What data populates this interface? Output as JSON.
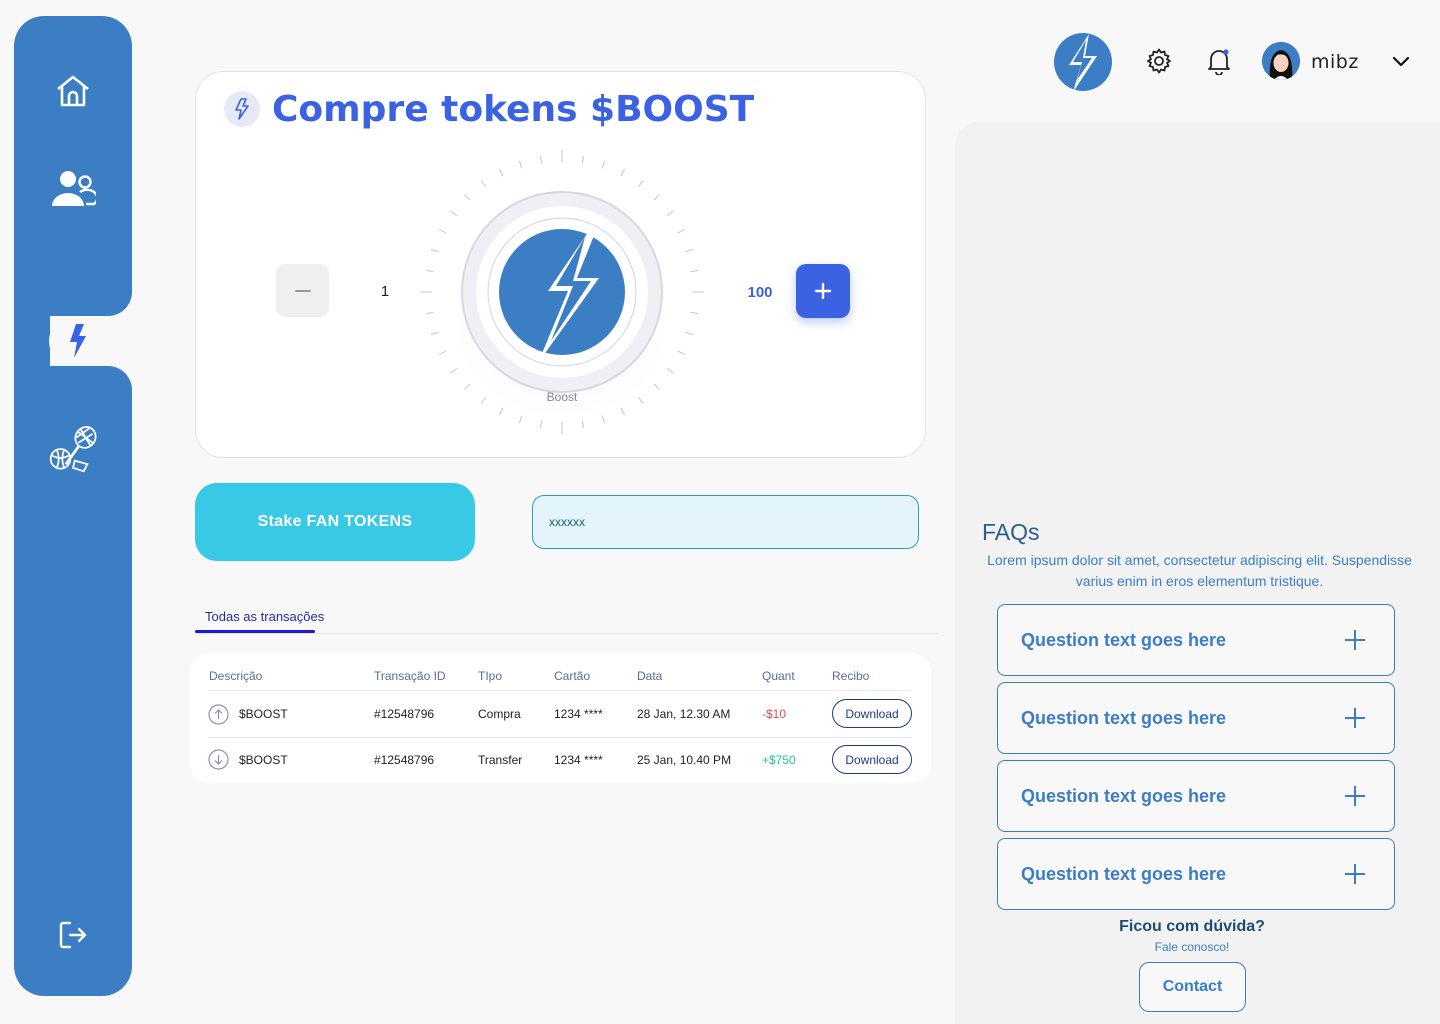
{
  "colors": {
    "sidebar": "#3b7ec4",
    "accent": "#3c62e4",
    "stake": "#38c9e6",
    "negative": "#e44b4b",
    "positive": "#22c49a"
  },
  "sidebar": {
    "items": [
      {
        "icon": "home-icon"
      },
      {
        "icon": "users-icon"
      },
      {
        "icon": "lightning-icon",
        "active": true
      },
      {
        "icon": "sports-icon"
      },
      {
        "icon": "logout-icon"
      }
    ]
  },
  "header": {
    "username": "mibz"
  },
  "token_card": {
    "title": "Compre tokens $BOOST",
    "min_value": "1",
    "max_value": "100",
    "dial_label": "Boost"
  },
  "stake": {
    "label": "Stake FAN TOKENS"
  },
  "token_input": {
    "value": "xxxxxx"
  },
  "tabs": [
    {
      "label": "Todas as transações",
      "active": true
    }
  ],
  "table": {
    "headers": [
      "Descrição",
      "Transação ID",
      "TIpo",
      "Cartão",
      "Data",
      "Quant",
      "Recibo"
    ],
    "rows": [
      {
        "direction": "up",
        "description": "$BOOST",
        "id": "#12548796",
        "type": "Compra",
        "card": "1234 ****",
        "date": "28 Jan, 12.30 AM",
        "amount": "-$10",
        "receipt": "Download"
      },
      {
        "direction": "down",
        "description": "$BOOST",
        "id": "#12548796",
        "type": "Transfer",
        "card": "1234 ****",
        "date": "25 Jan, 10.40 PM",
        "amount": "+$750",
        "receipt": "Download"
      }
    ]
  },
  "faq": {
    "title": "FAQs",
    "description": "Lorem ipsum dolor sit amet, consectetur adipiscing elit. Suspendisse varius enim in eros elementum tristique.",
    "questions": [
      "Question text goes here",
      "Question text goes here",
      "Question text goes here",
      "Question text goes here"
    ],
    "help_title": "Ficou com dúvida?",
    "help_subtitle": "Fale conosco!",
    "contact_label": "Contact"
  }
}
